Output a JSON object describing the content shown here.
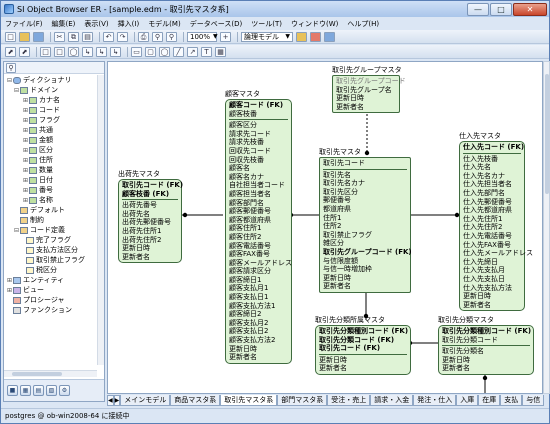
{
  "window": {
    "title": "SI Object Browser ER - [sample.edm - 取引先マスタ系]"
  },
  "menu": [
    "ファイル(F)",
    "編集(E)",
    "表示(V)",
    "挿入(I)",
    "モデル(M)",
    "データベース(D)",
    "ツール(T)",
    "ウィンドウ(W)",
    "ヘルプ(H)"
  ],
  "toolbar": {
    "zoom": "100%",
    "model_type": "論理モデル"
  },
  "tree": {
    "root": "ディクショナリ",
    "domain": "ドメイン",
    "domain_items": [
      "カナ名",
      "コード",
      "フラグ",
      "共通",
      "金額",
      "区分",
      "住所",
      "数量",
      "日付",
      "番号",
      "名称"
    ],
    "default": "デフォルト",
    "constraint": "制約",
    "code_def": "コード定義",
    "code_def_items": [
      "完了フラグ",
      "支払方法区分",
      "取引禁止フラグ",
      "税区分"
    ],
    "entity": "エンティティ",
    "view": "ビュー",
    "procedure": "プロシージャ",
    "function": "ファンクション"
  },
  "entities": {
    "shukka": {
      "title": "出荷先マスタ",
      "pk": [
        "取引先コード (FK)",
        "顧客枝番 (FK)"
      ],
      "attrs": [
        "出荷先番号",
        "出荷先名",
        "出荷先郵便番号",
        "出荷先住所1",
        "出荷先住所2",
        "更新日時",
        "更新者名"
      ]
    },
    "kokyaku": {
      "title": "顧客マスタ",
      "pk": [
        "顧客コード (FK)",
        "顧客枝番"
      ],
      "attrs": [
        "顧客区分",
        "請求先コード",
        "請求先枝番",
        "回収先コード",
        "回収先枝番",
        "顧客名",
        "顧客名カナ",
        "自社担当者コード",
        "顧客担当者名",
        "顧客部門名",
        "顧客郵便番号",
        "顧客都道府県",
        "顧客住所1",
        "顧客住所2",
        "顧客電話番号",
        "顧客FAX番号",
        "顧客メールアドレス",
        "顧客請求区分",
        "顧客締日1",
        "顧客支払月1",
        "顧客支払日1",
        "顧客支払方法1",
        "顧客締日2",
        "顧客支払月2",
        "顧客支払日2",
        "顧客支払方法2",
        "更新日時",
        "更新者名"
      ]
    },
    "group": {
      "title": "取引先グループマスタ",
      "attrs": [
        "取引先グループコード",
        "取引先グループ名",
        "更新日時",
        "更新者名"
      ]
    },
    "torihiki": {
      "title": "取引先マスタ",
      "pk": [
        "取引先コード"
      ],
      "attrs": [
        "取引先名",
        "取引先名カナ",
        "取引先区分",
        "郵便番号",
        "都道府県",
        "住所1",
        "住所2",
        "取引禁止フラグ",
        "雑区分",
        "取引先グループコード (FK)",
        "与信限度額",
        "与信一時増加枠",
        "更新日時",
        "更新者名"
      ],
      "key_attrs": [
        "取引先グループコード (FK)"
      ]
    },
    "shiire": {
      "title": "仕入先マスタ",
      "pk": [
        "仕入先コード (FK)"
      ],
      "attrs": [
        "仕入先枝番",
        "仕入先名",
        "仕入先名カナ",
        "仕入先担当者名",
        "仕入先部門名",
        "仕入先郵便番号",
        "仕入先都道府県",
        "仕入先住所1",
        "仕入先住所2",
        "仕入先電話番号",
        "仕入先FAX番号",
        "仕入先メールアドレス",
        "仕入先締日",
        "仕入先支払月",
        "仕入先支払日",
        "仕入先支払方法",
        "更新日時",
        "更新者名"
      ]
    },
    "bunrui_shozoku": {
      "title": "取引先分類所属マスタ",
      "pk": [
        "取引先分類種別コード (FK)",
        "取引先分類コード (FK)",
        "取引先コード (FK)"
      ],
      "attrs": [
        "更新日時",
        "更新者名"
      ]
    },
    "bunrui": {
      "title": "取引先分類マスタ",
      "pk": [
        "取引先分類種別コード (FK)",
        "取引先分類コード"
      ],
      "attrs": [
        "取引先分類名",
        "更新日時",
        "更新者名"
      ]
    }
  },
  "tabs": [
    "メインモデル",
    "商品マスタ系",
    "取引先マスタ系",
    "部門マスタ系",
    "受注・売上",
    "請求・入金",
    "発注・仕入",
    "入庫",
    "在庫",
    "支払",
    "与信"
  ],
  "active_tab": "取引先マスタ系",
  "status": {
    "connection": "postgres @ ob-win2008-64 に接続中"
  }
}
